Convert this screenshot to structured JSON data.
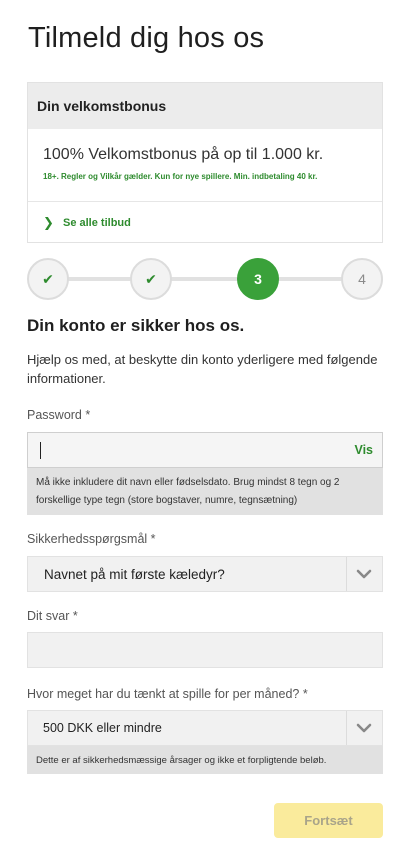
{
  "page": {
    "title": "Tilmeld dig hos os"
  },
  "bonus": {
    "header": "Din velkomstbonus",
    "headline": "100% Velkomstbonus på op til 1.000 kr.",
    "terms": "18+. Regler og Vilkår gælder. Kun for nye spillere. Min. indbetaling 40 kr.",
    "link_label": "Se alle tilbud"
  },
  "stepper": {
    "steps": [
      {
        "label": "✔",
        "state": "done"
      },
      {
        "label": "✔",
        "state": "done"
      },
      {
        "label": "3",
        "state": "active"
      },
      {
        "label": "4",
        "state": "todo"
      }
    ]
  },
  "section": {
    "title": "Din konto er sikker hos os.",
    "description": "Hjælp os med, at beskytte din konto yderligere med følgende informationer."
  },
  "password": {
    "label": "Password *",
    "value": "",
    "show_label": "Vis",
    "hint": "Må ikke inkludere dit navn eller fødselsdato. Brug mindst 8 tegn og 2 forskellige type tegn (store bogstaver, numre, tegnsætning)"
  },
  "security_question": {
    "label": "Sikkerhedsspørgsmål *",
    "selected": "Navnet på mit første kæledyr?"
  },
  "answer": {
    "label": "Dit svar *",
    "value": ""
  },
  "budget": {
    "label": "Hvor meget har du tænkt at spille for per måned? *",
    "selected": "500 DKK eller mindre",
    "hint": "Dette er af sikkerhedsmæssige årsager og ikke et forpligtende beløb."
  },
  "actions": {
    "continue_label": "Fortsæt"
  },
  "colors": {
    "accent_green": "#3aa13a",
    "link_green": "#2e8b2e",
    "button_disabled": "#faeb9c"
  }
}
